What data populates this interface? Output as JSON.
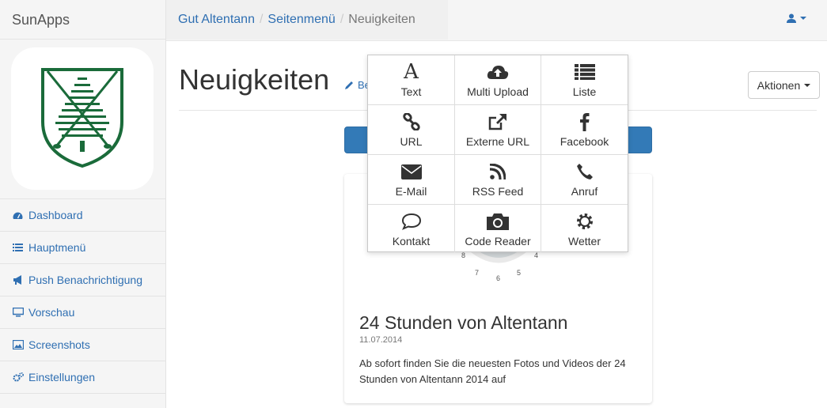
{
  "app": {
    "brand": "SunApps"
  },
  "breadcrumb": {
    "items": [
      "Gut Altentann",
      "Seitenmenü"
    ],
    "active": "Neuigkeiten"
  },
  "sidebar": {
    "items": [
      {
        "label": "Dashboard",
        "icon": "dashboard-icon"
      },
      {
        "label": "Hauptmenü",
        "icon": "list-icon"
      },
      {
        "label": "Push Benachrichtigung",
        "icon": "bullhorn-icon"
      },
      {
        "label": "Vorschau",
        "icon": "desktop-icon"
      },
      {
        "label": "Screenshots",
        "icon": "image-icon"
      },
      {
        "label": "Einstellungen",
        "icon": "gears-icon"
      }
    ]
  },
  "page": {
    "title": "Neuigkeiten",
    "edit_label": "Be",
    "actions_label": "Aktionen"
  },
  "popover": {
    "items": [
      {
        "label": "Text",
        "icon": "font-icon"
      },
      {
        "label": "Multi Upload",
        "icon": "cloud-upload-icon"
      },
      {
        "label": "Liste",
        "icon": "list-icon"
      },
      {
        "label": "URL",
        "icon": "link-icon"
      },
      {
        "label": "Externe URL",
        "icon": "external-link-icon"
      },
      {
        "label": "Facebook",
        "icon": "facebook-icon"
      },
      {
        "label": "E-Mail",
        "icon": "envelope-icon"
      },
      {
        "label": "RSS Feed",
        "icon": "rss-icon"
      },
      {
        "label": "Anruf",
        "icon": "phone-icon"
      },
      {
        "label": "Kontakt",
        "icon": "comment-icon"
      },
      {
        "label": "Code Reader",
        "icon": "camera-icon"
      },
      {
        "label": "Wetter",
        "icon": "gear-icon"
      }
    ]
  },
  "card": {
    "title": "24 Stunden von Altentann",
    "date": "11.07.2014",
    "text": "Ab sofort finden Sie die neuesten Fotos und Videos der 24 Stunden von Altentann 2014 auf",
    "dial_numbers": [
      "8",
      "7",
      "6",
      "5",
      "4"
    ]
  },
  "colors": {
    "link": "#2f6fb2",
    "primary": "#337ab7",
    "logo_green": "#1a6b3a"
  }
}
